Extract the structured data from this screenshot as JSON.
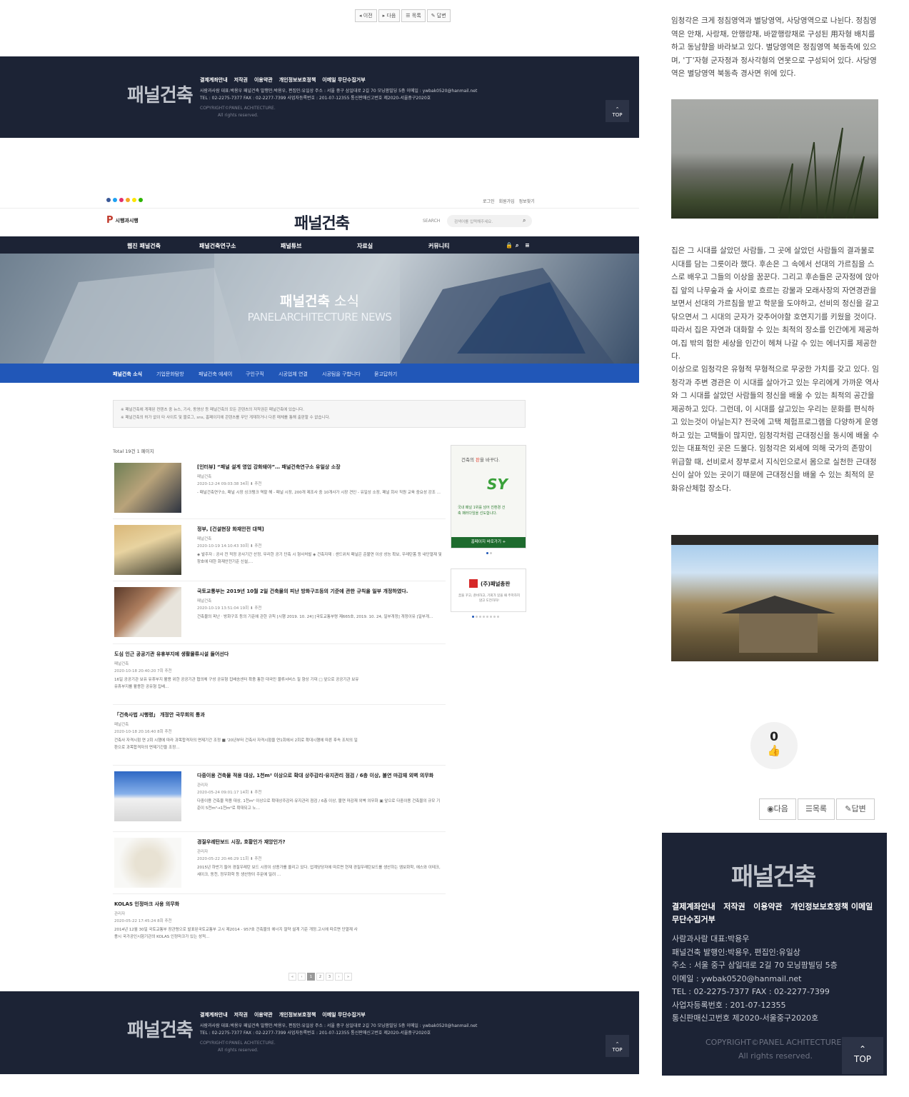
{
  "snippet_top": {
    "nav": {
      "prev": "이전",
      "next": "다음",
      "list": "목록",
      "reply": "답변"
    }
  },
  "footer": {
    "logo": "패널건축",
    "links": [
      "결제계좌안내",
      "저작권",
      "이용약관",
      "개인정보보호정책",
      "이메일 무단수집거부"
    ],
    "info_line1": "사람과사람 대표:박용우    패널건축 발행인:박용우, 편집인:유일상    주소 : 서울 중구 삼일대로 2길 70 모닝팜빌딩 5층    이메일 : ywbak0520@hanmail.net",
    "info_line2": "TEL : 02-2275-7377    FAX : 02-2277-7399    사업자등록번호 : 201-07-12355    통신판매신고번호 제2020-서울중구2020호",
    "copyright": "COPYRIGHT©PANEL ACHITECTURE.",
    "rights": "All rights reserved.",
    "top": "TOP"
  },
  "header": {
    "util": [
      "로그인",
      "회원가입",
      "정보찾기"
    ],
    "partner_logo": "시행과시행",
    "logo": "패널건축",
    "search_label": "SEARCH",
    "search_placeholder": "검색어를 입력해주세요."
  },
  "gnb": [
    "웹진 패널건축",
    "패널건축연구소",
    "패널튜브",
    "자료실",
    "커뮤니티"
  ],
  "hero": {
    "title": "패널건축",
    "title_light": "소식",
    "subtitle": "PANELARCHITECTURE NEWS"
  },
  "subnav": [
    "패널건축 소식",
    "기업문화탐방",
    "패널건축 에세이",
    "구인구직",
    "시공업체 연결",
    "시공팀을 구합니다",
    "묻고답하기"
  ],
  "notice": [
    "※ 패널건축에 게재된 컨텐츠 중 뉴스, 기사, 동영상 등 패널건축의 모든 콘텐츠의 저작권은 패널건축에 있습니다.",
    "※ 패널건축의 허가 없이 타 사이트 및 블로그, sns, 홈페이지에 콘텐츠를 무단 게재하거나 다른 매체를 통해 출판할 수 없습니다."
  ],
  "list_total": "Total 19건 1 페이지",
  "posts": [
    {
      "title": "[인터뷰] “패널 설계 영업 강화돼야”… 패널건축연구소 유일상 소장",
      "author": "패널건축",
      "meta": "2020-12-24 09:03:38    34회    ⬇    추천",
      "excerpt": "- 패널건축연구소, 패널 시장 싱크탱크 역할 해 - 패널 시장, 200개 제조사 중 10개사가 시장 견인 - 유일상 소장, 패널 회사 직원 교육 중요성 강조 …"
    },
    {
      "title": "정부, [건설현장 화재안전 대책]",
      "author": "패널건축",
      "meta": "2020-10-19 14:10:43    30회    ⬇    추천",
      "excerpt": "◈ 발주자 : 공사 전 적정 공사기간 산정, 무리한 공기 단축 시 형사처벌 ◈ 건축자재 : 샌드위치 패널은 준불연 이상 성능 확보, 우레탄폼 등 내단열재 및 창호에 대한 화재안전기준 신설,…"
    },
    {
      "title": "국토교통부는 2019년 10월 2일 건축물의 피난 방화구조등의 기준에 관한 규칙을 일부 개정하였다.",
      "author": "패널건축",
      "meta": "2020-10-19 13:51:04    19회    ⬇    추천",
      "excerpt": "건축물의 피난ㆍ방화구조 등의 기준에 관한 규칙 [시행 2019. 10. 24] [국토교통부령 제665호, 2019. 10. 24, 일부개정] 개정이유 [일부개…"
    },
    {
      "title": "도심 인근 공공기관 유휴부지에 생활물류시설 들어선다",
      "author": "패널건축",
      "meta": "2020-10-18 20:40:20    7회    추천",
      "excerpt": "16일 공공기관 보유 유휴부지 활용 위한 공공기관 협의체 구성 공유형 집배송센터 확충 통한 대국민 물류서비스 질 향상 기대 □ 앞으로 공공기관 보유 유휴부지를 활용한 공유형 집배…"
    },
    {
      "title": "「건축사법 시행령」 개정안 국무회의 통과",
      "author": "패널건축",
      "meta": "2020-10-18 20:16:40    8회    추천",
      "excerpt": "건축사 자격시험 연 2회 시행에 따라 과목합격자의 면제기간 조정 ■ '20년부터 건축사 자격시험을 연1회에서 2회로 확대시행에 따른 후속 조치의 일환으로 과목합격자의 면제기간을 조정…"
    },
    {
      "title": "다중이용 건축물 적용 대상, 1천m² 이상으로 확대 상주감리·유지관리 점검 / 6층 이상, 불연 마감재 외벽 의무화",
      "author": "관리자",
      "meta": "2020-05-24 09:01:17    14회    ⬇    추천",
      "excerpt": "다중이용 건축물 적용 대상, 1천m² 이상으로 확대상주감리·유지관리 점검 / 6층 이상, 불연 마감재 외벽 의무화 ▣ 앞으로 다중이용 건축물의 규모 기준이 5천m²→1천m²로 확대되고 노…"
    },
    {
      "title": "경질우레탄보드 시장, 호황인가 재앙인가?",
      "author": "관리자",
      "meta": "2020-05-22 20:46:29    11회    ⬇    추천",
      "excerpt": "2015년 하반기 들어 경질우레탄 보드 시장이 상종가를 올리고 있다. 업계당당자에 따르면 현재 경질우레탄보드를 생산하는 엠보화학, 에스와 이테크, 세이크, 동천, 정우화학 등 생산량이 주문에 밀려 …"
    },
    {
      "title": "KOLAS 인정마크 사용 의무화",
      "author": "관리자",
      "meta": "2020-05-22 17:45:24    8회    추천",
      "excerpt": "2014년 12월 30일 국토교통부 장관령으로 발표된국토교통부 고시 제2014 - 957호 건축물의 에너지 절약 설계 기준 개정.고시에 따르면 단열재 사용시 국가공인시험기관의 KOLAS 인정마크가 있는 성적…"
    }
  ],
  "ads": {
    "ad1_line1": "건축의",
    "ad1_highlight": "판",
    "ad1_line1b": "을 바꾸다.",
    "ad1_brand": "SY",
    "ad1_desc": "국내 패널 1위를 넘어 친환경 건축 패러다임을 선도합니다.",
    "ad1_btn": "홈페이지 바로가기 +",
    "ad2_name": "(주)패널총판",
    "ad2_desc": "꿈을 꾸고, 준비하고, 기회가 있을 때 주저하지 않고 도전하자!"
  },
  "pagination": [
    "«",
    "‹",
    "1",
    "2",
    "3",
    "›",
    "»"
  ],
  "mobile": {
    "para1": "임청각은 크게 정침영역과 별당영역, 사당영역으로 나뉜다. 정침영역은 안채, 사랑채, 안행랑채, 바깥행랑채로 구성된 用자형 배치를 하고 동남향을 바라보고 있다. 별당영역은 정침영역 북동측에 있으며, '丁'자형 군자정과 정사각형의 연못으로 구성되어 있다. 사당영역은 별당영역 북동측 경사면 위에 있다.",
    "para2": "집은 그 시대를 살았던 사람들, 그 곳에 살았던 사람들의 결과물로 시대를 담는 그릇이라 했다. 후손은 그 속에서 선대의 가르침을 스스로 배우고 그들의 이상을 꿈꾼다. 그리고 후손들은 군자정에 앉아 집 앞의 나무숲과 숲 사이로 흐르는 강물과 모래사장의 자연경관을 보면서 선대의 가르침을 받고 학문을 도야하고, 선비의 정신을 갈고 닦으면서 그 시대의 군자가 갖추어야할 호연지기를 키웠을 것이다. 따라서 집은 자연과 대화할 수 있는 최적의 장소를 인간에게 제공하여,집 밖의 험한 세상을 인간이 헤쳐 나갈 수 있는 에너지를 제공한다.",
    "para3": "이상으로 임청각은 유형적 무형적으로 무궁한 가치를 갖고 있다. 임청각과 주변 경관은 이 시대를 살아가고 있는 우리에게 가까운 역사와 그 시대를 살았던 사람들의 정신을 배울 수 있는 최적의 공간을 제공하고 있다. 그런데, 이 시대를 살고있는 우리는 문화를 편식하고 있는것이 아닐는지? 전국에 고택 체험프로그램을 다양하게 운영하고 있는 고택들이 많지만, 임청각처럼 근대정신을 동시에 배울 수 있는 대표적인 곳은 드물다. 임청각은 외세에 의해 국가의 존망이 위급할 때, 선비로서 장부로서 지식인으로서 몸으로 실천한 근대정신이 살아 있는 곳이기 때문에 근대정신을 배울 수 있는 최적의 문화유산체험 장소다.",
    "like_count": "0",
    "btn_next": "다음",
    "btn_list": "목록",
    "btn_reply": "답변",
    "footer_links": [
      "결제계좌안내",
      "저작권",
      "이용약관",
      "개인정보보호정책",
      "이메일 무단수집거부"
    ],
    "footer_info": [
      "사람과사람 대표:박용우",
      "패널건축 발행인:박용우, 편집인:유일상",
      "주소 : 서울 중구 삼일대로 2길 70 모닝팜빌딩 5층",
      "이메일 : ywbak0520@hanmail.net",
      "TEL : 02-2275-7377    FAX : 02-2277-7399",
      "사업자등록번호 : 201-07-12355",
      "통신판매신고번호 제2020-서울중구2020호"
    ],
    "copyright": "COPYRIGHT©PANEL ACHITECTURE",
    "rights": "All rights reserved.",
    "top": "TOP"
  }
}
